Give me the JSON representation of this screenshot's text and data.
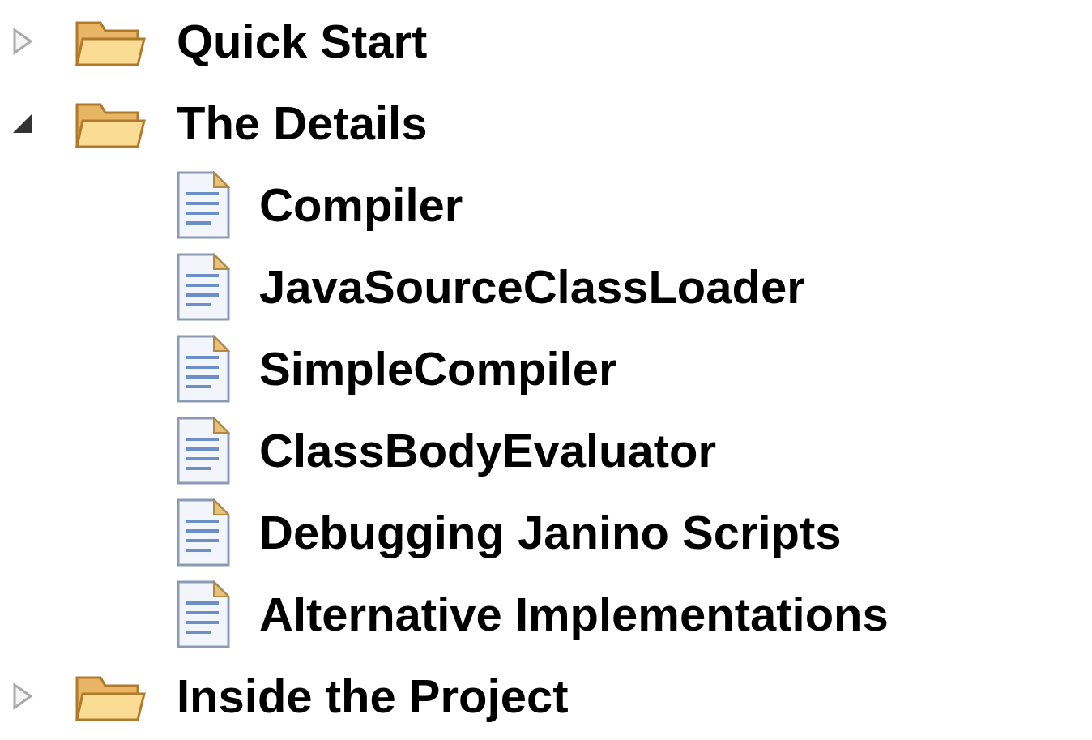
{
  "tree": [
    {
      "label": "Quick Start",
      "kind": "folder",
      "expanded": false
    },
    {
      "label": "The Details",
      "kind": "folder",
      "expanded": true,
      "children": [
        {
          "label": "Compiler",
          "kind": "page"
        },
        {
          "label": "JavaSourceClassLoader",
          "kind": "page"
        },
        {
          "label": "SimpleCompiler",
          "kind": "page"
        },
        {
          "label": "ClassBodyEvaluator",
          "kind": "page"
        },
        {
          "label": "Debugging Janino Scripts",
          "kind": "page"
        },
        {
          "label": "Alternative Implementations",
          "kind": "page"
        }
      ]
    },
    {
      "label": "Inside the Project",
      "kind": "folder",
      "expanded": false
    }
  ]
}
